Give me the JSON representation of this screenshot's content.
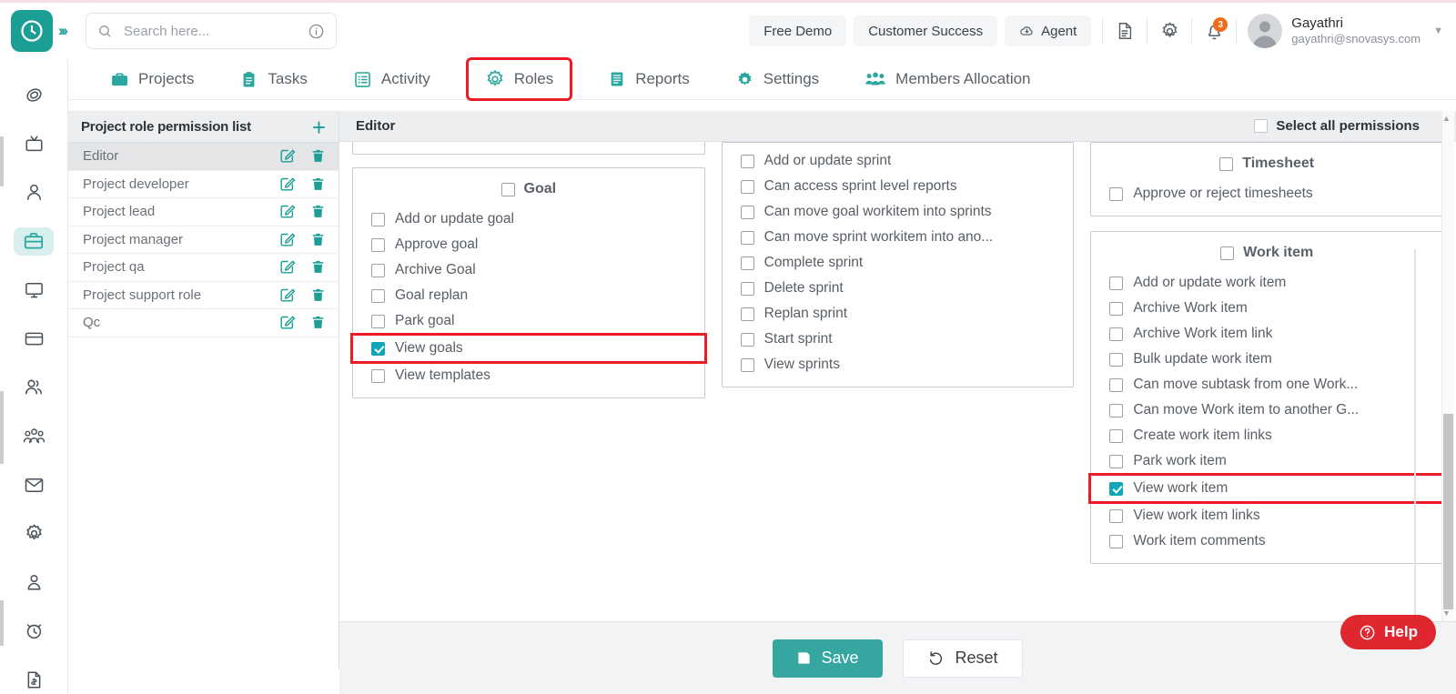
{
  "header": {
    "logo_icon": "clock-logo-icon",
    "expand_icon": "chevron-double-right-icon",
    "search": {
      "placeholder": "Search here...",
      "value": "",
      "icon": "search-icon",
      "info_icon": "info-circle-icon"
    },
    "pills": [
      {
        "label": "Free Demo",
        "name": "free-demo-button",
        "icon": null
      },
      {
        "label": "Customer Success",
        "name": "customer-success-button",
        "icon": null
      },
      {
        "label": "Agent",
        "name": "agent-button",
        "icon": "agent-cloud-icon"
      }
    ],
    "icons": [
      {
        "name": "document-icon"
      },
      {
        "name": "gear-icon"
      }
    ],
    "notifications": {
      "icon": "bell-icon",
      "count": "3",
      "badge_color": "#ef6c1a"
    },
    "user": {
      "name": "Gayathri",
      "email": "gayathri@snovasys.com",
      "avatar": "avatar",
      "caret": "chevron-down-icon"
    }
  },
  "nav": {
    "tabs": [
      {
        "label": "Projects",
        "icon": "briefcase-icon",
        "active": false
      },
      {
        "label": "Tasks",
        "icon": "clipboard-icon",
        "active": false
      },
      {
        "label": "Activity",
        "icon": "list-box-icon",
        "active": false
      },
      {
        "label": "Roles",
        "icon": "roles-target-icon",
        "active": true
      },
      {
        "label": "Reports",
        "icon": "report-icon",
        "active": false
      },
      {
        "label": "Settings",
        "icon": "gear-icon",
        "active": false
      },
      {
        "label": "Members Allocation",
        "icon": "members-icon",
        "active": false
      }
    ]
  },
  "rail": {
    "items": [
      {
        "name": "sidebar-item-dashboard",
        "icon": "spiral-icon",
        "active": false
      },
      {
        "name": "sidebar-item-tv",
        "icon": "tv-icon",
        "active": false
      },
      {
        "name": "sidebar-item-profile",
        "icon": "person-icon",
        "active": false
      },
      {
        "name": "sidebar-item-projects",
        "icon": "briefcase-icon",
        "active": true
      },
      {
        "name": "sidebar-item-monitor",
        "icon": "monitor-icon",
        "active": false
      },
      {
        "name": "sidebar-item-billing",
        "icon": "card-icon",
        "active": false
      },
      {
        "name": "sidebar-item-users",
        "icon": "users-icon",
        "active": false
      },
      {
        "name": "sidebar-item-teams",
        "icon": "team-icon",
        "active": false
      },
      {
        "name": "sidebar-item-mail",
        "icon": "envelope-icon",
        "active": false
      },
      {
        "name": "sidebar-item-settings",
        "icon": "gear-icon",
        "active": false
      },
      {
        "name": "sidebar-item-account",
        "icon": "person-badge-icon",
        "active": false
      },
      {
        "name": "sidebar-item-timer",
        "icon": "alarm-clock-icon",
        "active": false
      },
      {
        "name": "sidebar-item-invoice",
        "icon": "invoice-icon",
        "active": false
      }
    ]
  },
  "roles_panel": {
    "title": "Project role permission list",
    "add_icon": "plus-icon",
    "edit_icon": "edit-icon",
    "delete_icon": "trash-icon",
    "roles": [
      {
        "label": "Editor",
        "selected": true
      },
      {
        "label": "Project developer",
        "selected": false
      },
      {
        "label": "Project lead",
        "selected": false
      },
      {
        "label": "Project manager",
        "selected": false
      },
      {
        "label": "Project qa",
        "selected": false
      },
      {
        "label": "Project support role",
        "selected": false
      },
      {
        "label": "Qc",
        "selected": false
      }
    ]
  },
  "content": {
    "title": "Editor",
    "select_all_label": "Select all permissions",
    "select_all_checked": false,
    "columns": [
      {
        "name": "column-goal",
        "partial_card_above": true,
        "cards": [
          {
            "title": "Goal",
            "title_checked": false,
            "permissions": [
              {
                "label": "Add or update goal",
                "checked": false,
                "highlight": false
              },
              {
                "label": "Approve goal",
                "checked": false,
                "highlight": false
              },
              {
                "label": "Archive Goal",
                "checked": false,
                "highlight": false
              },
              {
                "label": "Goal replan",
                "checked": false,
                "highlight": false
              },
              {
                "label": "Park goal",
                "checked": false,
                "highlight": false
              },
              {
                "label": "View goals",
                "checked": true,
                "highlight": true
              },
              {
                "label": "View templates",
                "checked": false,
                "highlight": false
              }
            ]
          }
        ]
      },
      {
        "name": "column-sprint",
        "partial_card_above": false,
        "cards": [
          {
            "title": null,
            "title_checked": false,
            "permissions": [
              {
                "label": "Add or update sprint",
                "checked": false,
                "highlight": false
              },
              {
                "label": "Can access sprint level reports",
                "checked": false,
                "highlight": false
              },
              {
                "label": "Can move goal workitem into sprints",
                "checked": false,
                "highlight": false
              },
              {
                "label": "Can move sprint workitem into ano...",
                "checked": false,
                "highlight": false
              },
              {
                "label": "Complete sprint",
                "checked": false,
                "highlight": false
              },
              {
                "label": "Delete sprint",
                "checked": false,
                "highlight": false
              },
              {
                "label": "Replan sprint",
                "checked": false,
                "highlight": false
              },
              {
                "label": "Start sprint",
                "checked": false,
                "highlight": false
              },
              {
                "label": "View sprints",
                "checked": false,
                "highlight": false
              }
            ]
          }
        ]
      },
      {
        "name": "column-work-item",
        "partial_card_above": false,
        "cards": [
          {
            "title": "Timesheet",
            "title_checked": false,
            "permissions": [
              {
                "label": "Approve or reject timesheets",
                "checked": false,
                "highlight": false
              }
            ]
          },
          {
            "title": "Work item",
            "title_checked": false,
            "permissions": [
              {
                "label": "Add or update work item",
                "checked": false,
                "highlight": false
              },
              {
                "label": "Archive Work item",
                "checked": false,
                "highlight": false
              },
              {
                "label": "Archive Work item link",
                "checked": false,
                "highlight": false
              },
              {
                "label": "Bulk update work item",
                "checked": false,
                "highlight": false
              },
              {
                "label": "Can move subtask from one Work...",
                "checked": false,
                "highlight": false
              },
              {
                "label": "Can move Work item to another G...",
                "checked": false,
                "highlight": false
              },
              {
                "label": "Create work item links",
                "checked": false,
                "highlight": false
              },
              {
                "label": "Park work item",
                "checked": false,
                "highlight": false
              },
              {
                "label": "View work item",
                "checked": true,
                "highlight": true
              },
              {
                "label": "View work item links",
                "checked": false,
                "highlight": false
              },
              {
                "label": "Work item comments",
                "checked": false,
                "highlight": false
              }
            ]
          }
        ]
      }
    ]
  },
  "footer": {
    "save_label": "Save",
    "save_icon": "floppy-save-icon",
    "reset_label": "Reset",
    "reset_icon": "undo-icon"
  },
  "help": {
    "label": "Help",
    "icon": "question-circle-icon"
  },
  "colors": {
    "brand_teal": "#1a9e96",
    "checkbox_checked": "#0fa6b8",
    "annotation_red": "#ec1c24",
    "help_red": "#e0262f",
    "badge_orange": "#ef6c1a"
  }
}
